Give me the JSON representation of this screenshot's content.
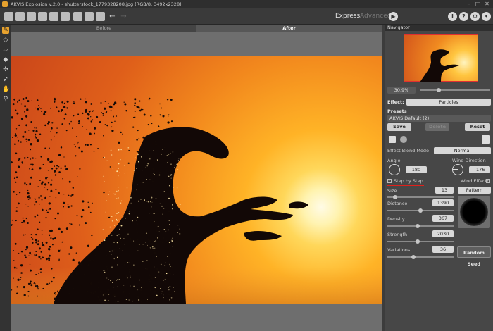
{
  "window": {
    "title": "AKVIS Explosion v.2.0 - shutterstock_1779328208.jpg (RGB/8, 3492x2328)"
  },
  "toolbar": {
    "mode_express": "Express",
    "mode_advanced": "Advanced"
  },
  "tabs": {
    "before": "Before",
    "after": "After"
  },
  "navigator": {
    "title": "Navigator",
    "zoom": "30.9%"
  },
  "effect": {
    "label": "Effect:",
    "value": "Particles"
  },
  "presets": {
    "label": "Presets",
    "selected": "AKVIS Default (2)",
    "save": "Save",
    "delete": "Delete",
    "reset": "Reset"
  },
  "params": {
    "blend_mode_label": "Effect Blend Mode",
    "blend_mode_value": "Normal",
    "angle_label": "Angle",
    "angle_value": "180",
    "wind_direction_label": "Wind Direction",
    "wind_direction_value": "-176",
    "step_by_step": "Step by Step",
    "wind_effect": "Wind Effect",
    "size_label": "Size",
    "size_value": "13",
    "pattern_label": "Pattern",
    "distance_label": "Distance",
    "distance_value": "1390",
    "density_label": "Density",
    "density_value": "367",
    "strength_label": "Strength",
    "strength_value": "2030",
    "variations_label": "Variations",
    "variations_value": "36",
    "random_seed": "Random Seed"
  },
  "colors": {
    "accent": "#e7a22e",
    "highlight_line": "#e0201a"
  }
}
